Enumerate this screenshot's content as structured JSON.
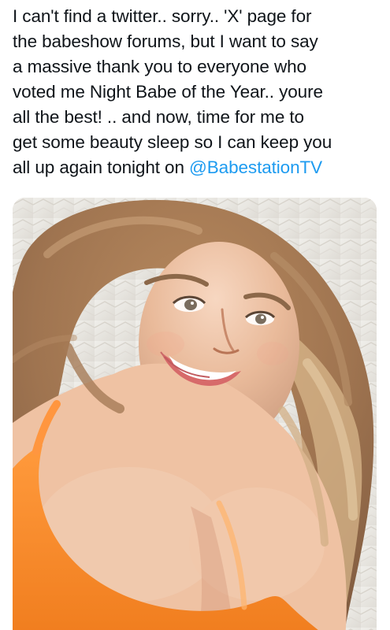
{
  "tweet": {
    "lines": [
      "I can't find a twitter.. sorry.. 'X' page for",
      "the babeshow forums, but I want to say",
      "a massive thank you to everyone who",
      "voted  me Night Babe of the Year.. youre",
      "all the best! .. and now, time for me to",
      "get some beauty sleep so I can keep you"
    ],
    "last_line_prefix": "all up again tonight on ",
    "mention": "@BabestationTV"
  },
  "colors": {
    "text": "#0f1419",
    "mention": "#1d9bf0",
    "top_color": "#ff8a2a"
  },
  "media": {
    "icon": "photo"
  }
}
